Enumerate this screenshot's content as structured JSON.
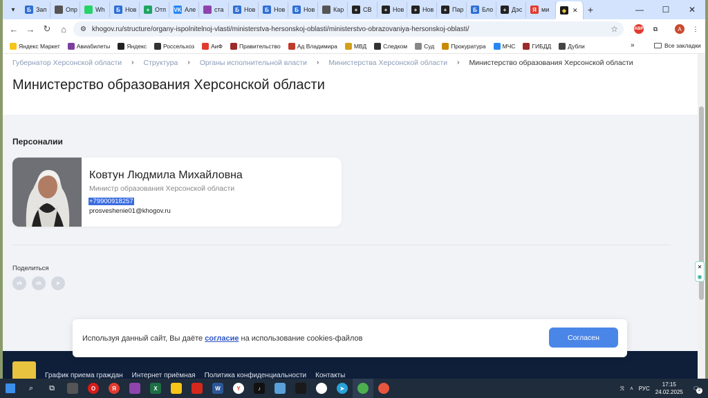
{
  "browser": {
    "tabs": [
      {
        "label": "Зап",
        "icon": "Б",
        "color": "#2f6fd6"
      },
      {
        "label": "Опр",
        "icon": "globe",
        "color": "#555555"
      },
      {
        "label": "Wh",
        "icon": "whatsapp",
        "color": "#25d366"
      },
      {
        "label": "Нов",
        "icon": "Б",
        "color": "#2f6fd6"
      },
      {
        "label": "Отп",
        "icon": "+",
        "color": "#1fa463"
      },
      {
        "label": "Але",
        "icon": "VK",
        "color": "#2787f5"
      },
      {
        "label": "ста",
        "icon": "chart",
        "color": "#8e44ad"
      },
      {
        "label": "Нов",
        "icon": "Б",
        "color": "#2f6fd6"
      },
      {
        "label": "Нов",
        "icon": "Б",
        "color": "#2f6fd6"
      },
      {
        "label": "Нов",
        "icon": "Б",
        "color": "#2f6fd6"
      },
      {
        "label": "Кар",
        "icon": "map",
        "color": "#555555"
      },
      {
        "label": "СВ",
        "icon": "+",
        "color": "#222222"
      },
      {
        "label": "Нов",
        "icon": "+",
        "color": "#222222"
      },
      {
        "label": "Нов",
        "icon": "+",
        "color": "#222222"
      },
      {
        "label": "Пар",
        "icon": "+",
        "color": "#222222"
      },
      {
        "label": "Бло",
        "icon": "Б",
        "color": "#2f6fd6"
      },
      {
        "label": "Дэс",
        "icon": "+",
        "color": "#222222"
      },
      {
        "label": "ми",
        "icon": "Я",
        "color": "#e23b2e"
      }
    ],
    "active_tab_icon": "gerb",
    "url": "khogov.ru/structure/organy-ispolnitelnoj-vlasti/ministerstva-hersonskoj-oblasti/ministerstvo-obrazovaniya-hersonskoj-oblasti/",
    "bookmarks": [
      {
        "label": "Яндекс Маркет",
        "color": "#f5c518"
      },
      {
        "label": "Авиабилеты",
        "color": "#7b3fa0"
      },
      {
        "label": "Яндекс",
        "color": "#222222"
      },
      {
        "label": "Россельхоз",
        "color": "#333333"
      },
      {
        "label": "АиФ",
        "color": "#e23b2e"
      },
      {
        "label": "Правительство",
        "color": "#9c2a2a"
      },
      {
        "label": "Ад Владимира",
        "color": "#c0392b"
      },
      {
        "label": "МВД",
        "color": "#d4a017"
      },
      {
        "label": "Следком",
        "color": "#333333"
      },
      {
        "label": "Суд",
        "color": "#888888"
      },
      {
        "label": "Прокуратура",
        "color": "#c98a00"
      },
      {
        "label": "МЧС",
        "color": "#2787f5"
      },
      {
        "label": "ГИБДД",
        "color": "#9c2a2a"
      },
      {
        "label": "Дубли",
        "color": "#444444"
      }
    ],
    "bookmarks_more": "»",
    "all_bookmarks": "Все закладки"
  },
  "page": {
    "breadcrumb": [
      "Губернатор Херсонской области",
      "Структура",
      "Органы исполнительной власти",
      "Министерства Херсонской области",
      "Министерство образования Херсонской области"
    ],
    "title": "Министерство образования Херсонской области",
    "section_title": "Персоналии",
    "person": {
      "name": "Ковтун Людмила Михайловна",
      "role": "Министр образования Херсонской области",
      "phone": "+79900918257",
      "email": "prosveshenie01@khogov.ru"
    },
    "share_label": "Поделиться",
    "share_buttons": [
      "vk",
      "ok",
      "telegram"
    ]
  },
  "cookie": {
    "text_before": "Используя данный сайт, Вы даёте ",
    "link": "согласие",
    "text_after": " на использование cookies-файлов",
    "button": "Согласен"
  },
  "footer": {
    "links": [
      "График приема граждан",
      "Интернет приёмная",
      "Политика конфиденциальности",
      "Контакты"
    ]
  },
  "taskbar": {
    "lang": "РУС",
    "time": "17:15",
    "date": "24.02.2025",
    "notifications": "2"
  }
}
